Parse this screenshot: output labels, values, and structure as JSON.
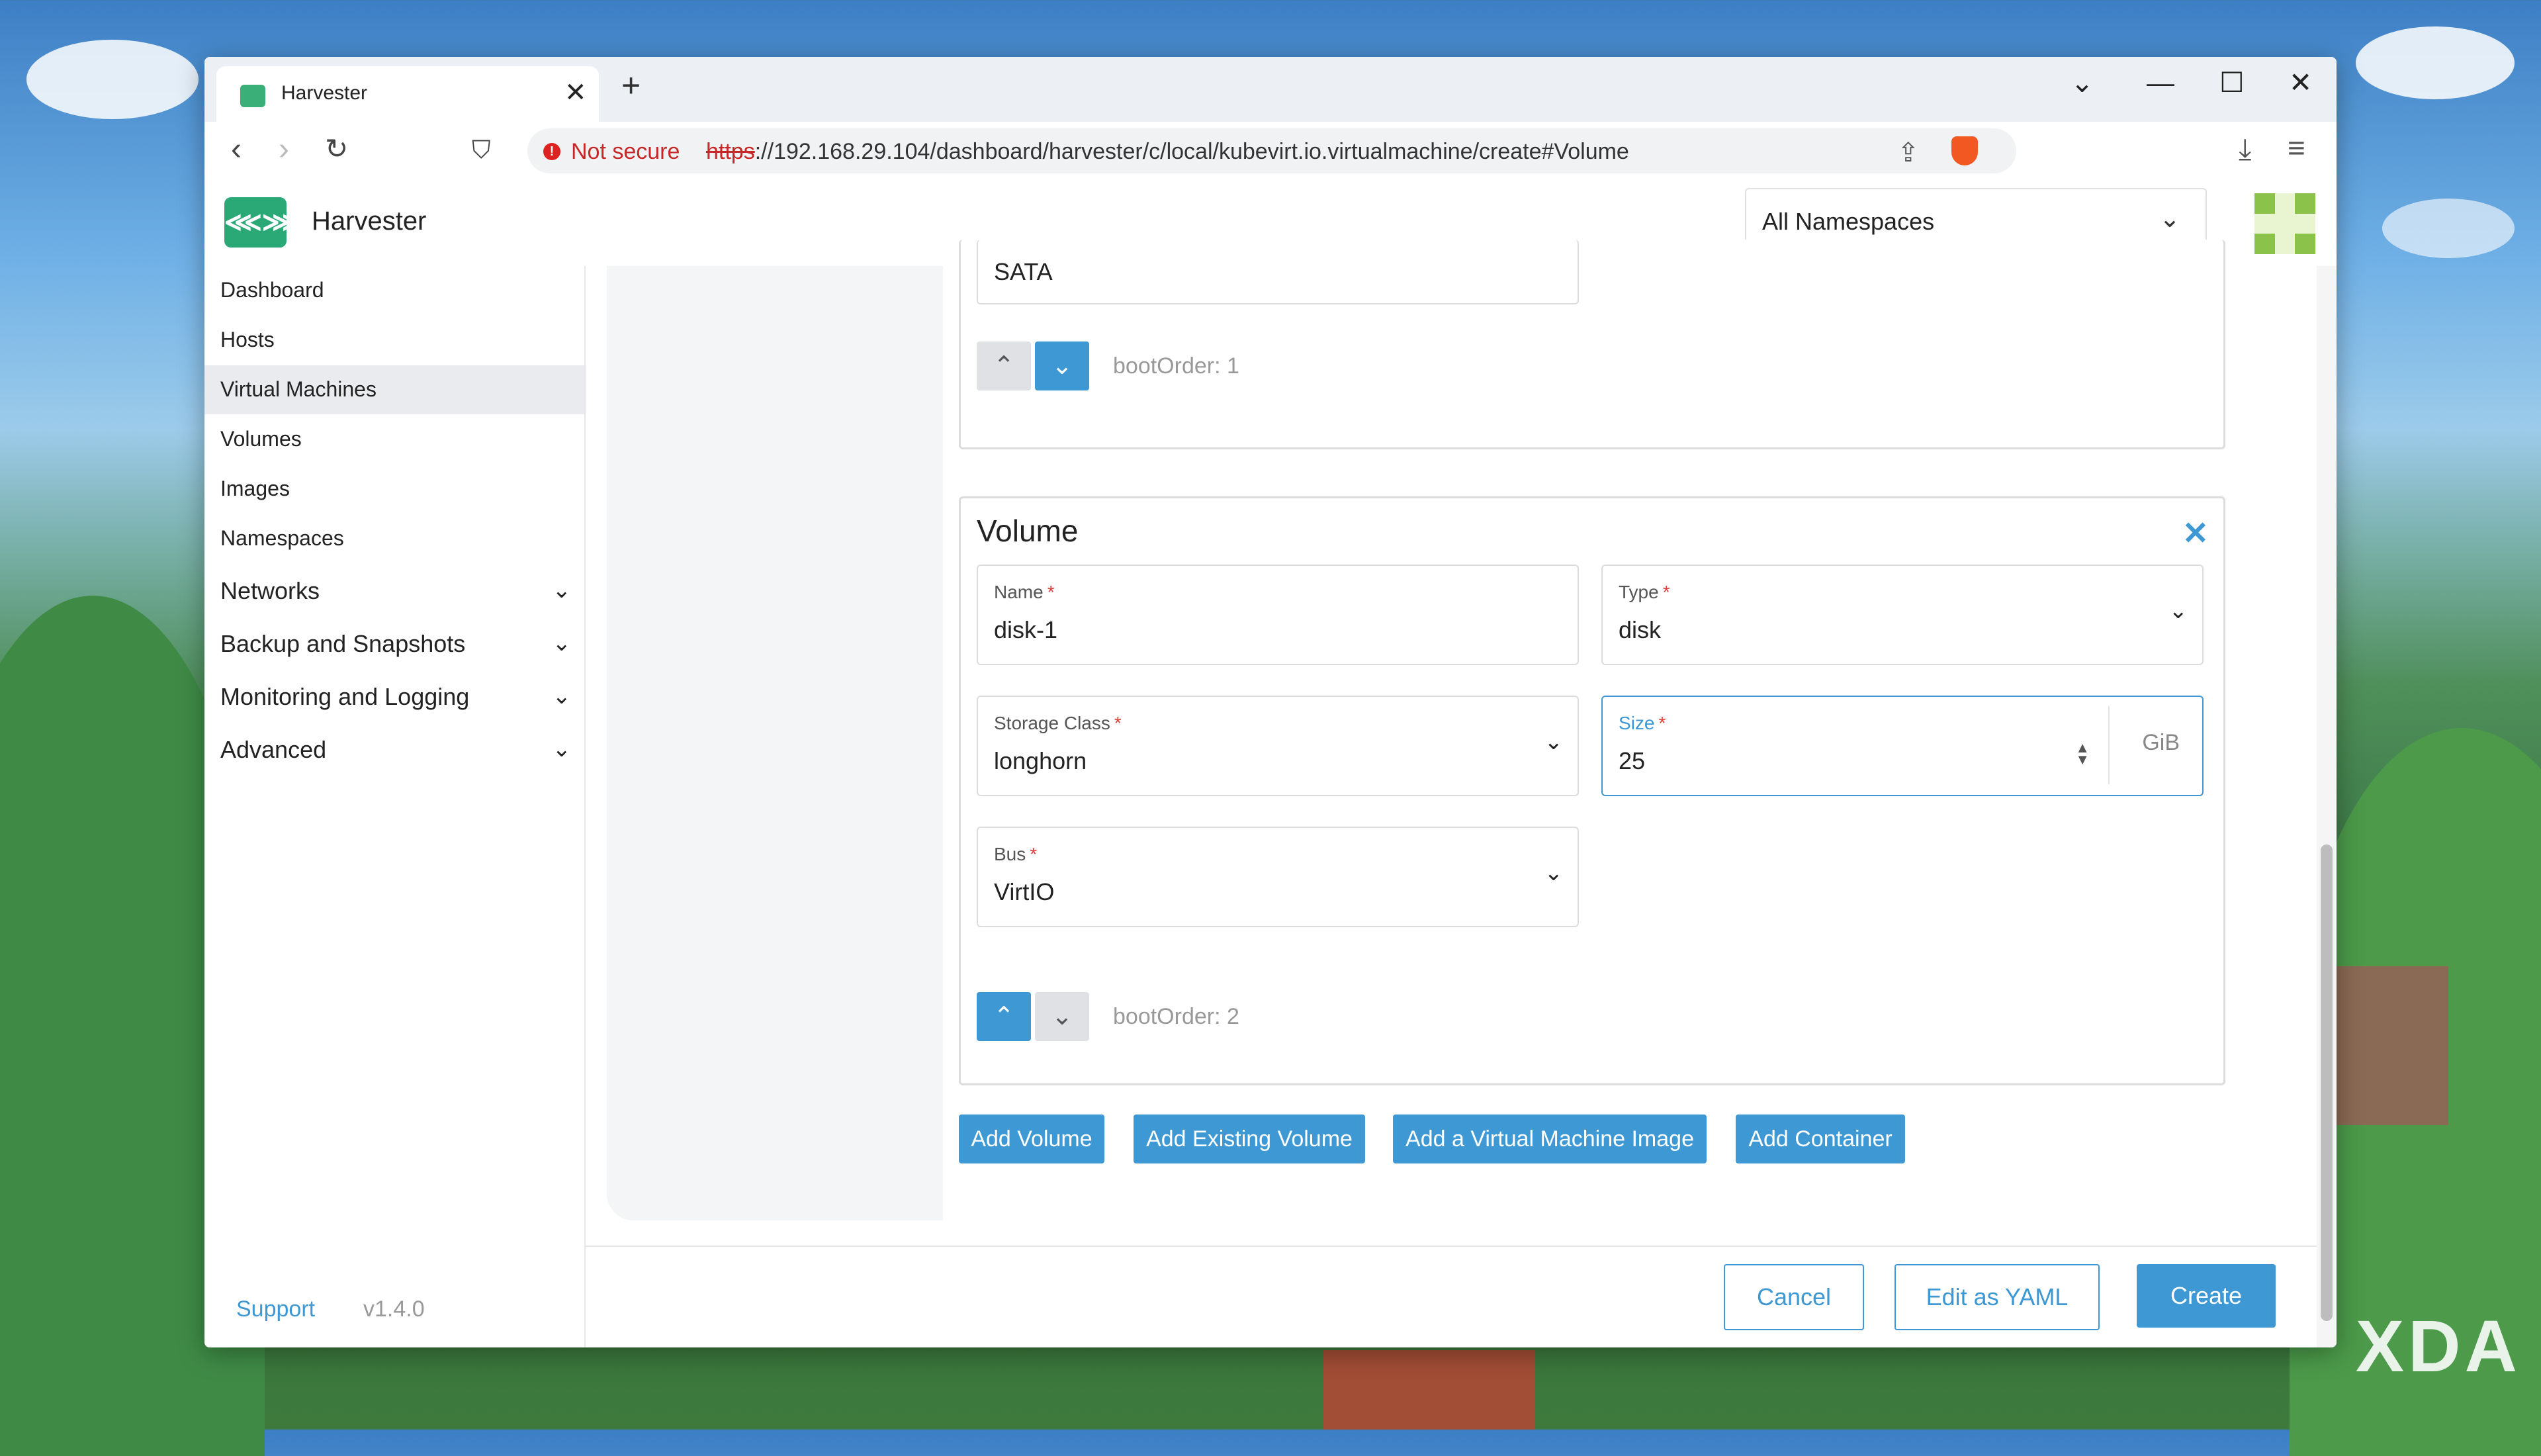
{
  "browser": {
    "tab_title": "Harvester",
    "security_label": "Not secure",
    "url_protocol": "https",
    "url_rest": "://192.168.29.104/dashboard/harvester/c/local/kubevirt.io.virtualmachine/create#Volume"
  },
  "app": {
    "title": "Harvester",
    "namespace_select": "All Namespaces"
  },
  "sidebar": {
    "items": [
      "Dashboard",
      "Hosts",
      "Virtual Machines",
      "Volumes",
      "Images",
      "Namespaces"
    ],
    "groups": [
      "Networks",
      "Backup and Snapshots",
      "Monitoring and Logging",
      "Advanced"
    ],
    "active": "Virtual Machines",
    "support_label": "Support",
    "version": "v1.4.0"
  },
  "prev_card": {
    "bus_value": "SATA",
    "boot_order": "bootOrder: 1"
  },
  "volume_card": {
    "title": "Volume",
    "name_label": "Name",
    "name_value": "disk-1",
    "type_label": "Type",
    "type_value": "disk",
    "storage_label": "Storage Class",
    "storage_value": "longhorn",
    "size_label": "Size",
    "size_value": "25",
    "size_unit": "GiB",
    "bus_label": "Bus",
    "bus_value": "VirtIO",
    "boot_order": "bootOrder: 2",
    "required_mark": "*"
  },
  "actions": {
    "add_volume": "Add Volume",
    "add_existing": "Add Existing Volume",
    "add_image": "Add a Virtual Machine Image",
    "add_container": "Add Container"
  },
  "footer": {
    "cancel": "Cancel",
    "edit_yaml": "Edit as YAML",
    "create": "Create"
  },
  "watermark": "XDA",
  "colors": {
    "accent": "#3d98d3",
    "brand": "#2aa876",
    "danger": "#c62828"
  }
}
